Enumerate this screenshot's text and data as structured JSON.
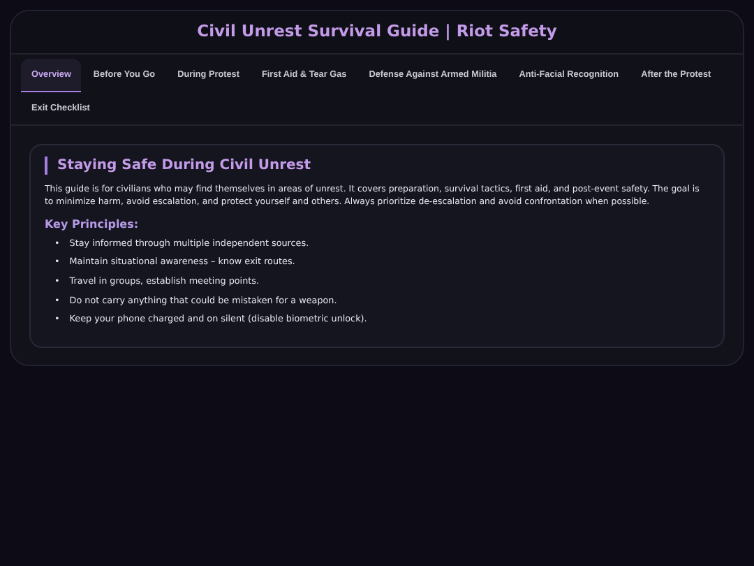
{
  "title": "Civil Unrest Survival Guide | Riot Safety",
  "tabs": [
    {
      "label": "Overview",
      "selected": true
    },
    {
      "label": "Before You Go",
      "selected": false
    },
    {
      "label": "During Protest",
      "selected": false
    },
    {
      "label": "First Aid & Tear Gas",
      "selected": false
    },
    {
      "label": "Defense Against Armed Militia",
      "selected": false
    },
    {
      "label": "Anti-Facial Recognition",
      "selected": false
    },
    {
      "label": "After the Protest",
      "selected": false
    },
    {
      "label": "Exit Checklist",
      "selected": false
    }
  ],
  "section": {
    "heading": "Staying Safe During Civil Unrest",
    "intro": "This guide is for civilians who may find themselves in areas of unrest. It covers preparation, survival tactics, first aid, and post-event safety. The goal is to minimize harm, avoid escalation, and protect yourself and others. Always prioritize de-escalation and avoid confrontation when possible.",
    "subheading": "Key Principles:",
    "items": [
      {
        "bullet": "•",
        "text": "Stay informed through multiple independent sources."
      },
      {
        "bullet": "•",
        "text": "Maintain situational awareness – know exit routes."
      },
      {
        "bullet": "•",
        "text": "Travel in groups, establish meeting points."
      },
      {
        "bullet": "•",
        "text": "Do not carry anything that could be mistaken for a weapon."
      },
      {
        "bullet": "•",
        "text": "Keep your phone charged and on silent (disable biometric unlock)."
      }
    ]
  }
}
